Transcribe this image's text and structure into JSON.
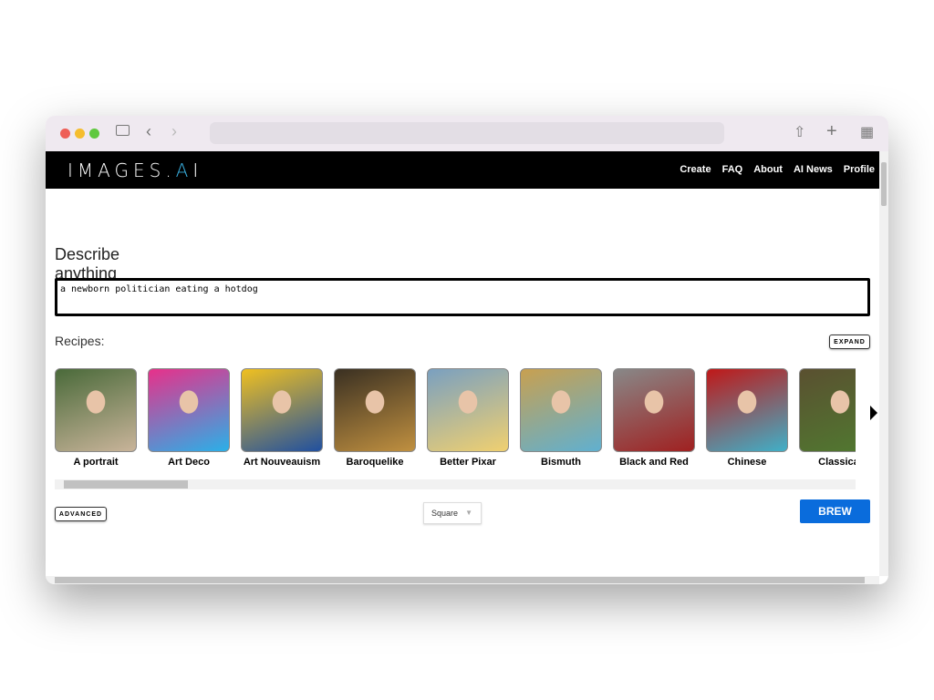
{
  "browser": {
    "url": "",
    "icons": [
      "sidebar-icon",
      "back-icon",
      "forward-icon",
      "share-icon",
      "new-tab-icon",
      "tab-overview-icon"
    ]
  },
  "nav": {
    "logo": "IMAGES.AI",
    "links": [
      "Create",
      "FAQ",
      "About",
      "AI News",
      "Profile"
    ]
  },
  "prompt": {
    "heading": "Describe anything",
    "value": "a newborn politician eating a hotdog"
  },
  "recipes": {
    "label": "Recipes:",
    "expand": "EXPAND",
    "items": [
      {
        "name": "A portrait",
        "colors": [
          "#4a6a3a",
          "#c9b49a"
        ]
      },
      {
        "name": "Art Deco",
        "colors": [
          "#e8308a",
          "#2ab0e8"
        ]
      },
      {
        "name": "Art Nouveauism",
        "colors": [
          "#f0c020",
          "#2050a0"
        ]
      },
      {
        "name": "Baroquelike",
        "colors": [
          "#3a3022",
          "#c09040"
        ]
      },
      {
        "name": "Better Pixar",
        "colors": [
          "#7aa0c0",
          "#f0d070"
        ]
      },
      {
        "name": "Bismuth",
        "colors": [
          "#c8a050",
          "#60b0d0"
        ]
      },
      {
        "name": "Black and Red",
        "colors": [
          "#888888",
          "#a02020"
        ]
      },
      {
        "name": "Chinese",
        "colors": [
          "#c01818",
          "#40b0c8"
        ]
      },
      {
        "name": "Classical",
        "colors": [
          "#5a5030",
          "#507a30"
        ]
      }
    ]
  },
  "controls": {
    "advanced": "ADVANCED",
    "aspect": "Square",
    "brew": "BREW"
  },
  "colors": {
    "accent": "#0a6cdc",
    "nav_bg": "#000000"
  }
}
